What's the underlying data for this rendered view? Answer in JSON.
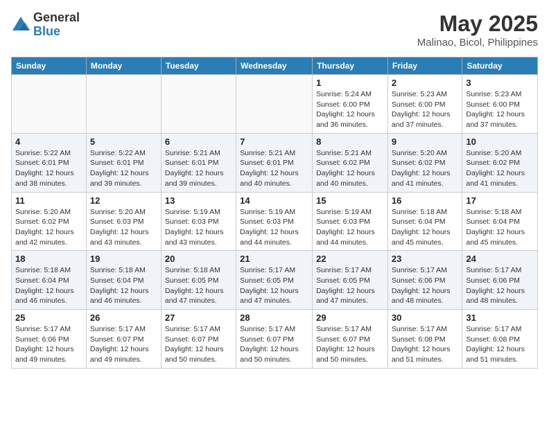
{
  "header": {
    "logo_general": "General",
    "logo_blue": "Blue",
    "title": "May 2025",
    "location": "Malinao, Bicol, Philippines"
  },
  "weekdays": [
    "Sunday",
    "Monday",
    "Tuesday",
    "Wednesday",
    "Thursday",
    "Friday",
    "Saturday"
  ],
  "weeks": [
    [
      {
        "day": "",
        "info": ""
      },
      {
        "day": "",
        "info": ""
      },
      {
        "day": "",
        "info": ""
      },
      {
        "day": "",
        "info": ""
      },
      {
        "day": "1",
        "info": "Sunrise: 5:24 AM\nSunset: 6:00 PM\nDaylight: 12 hours and 36 minutes."
      },
      {
        "day": "2",
        "info": "Sunrise: 5:23 AM\nSunset: 6:00 PM\nDaylight: 12 hours and 37 minutes."
      },
      {
        "day": "3",
        "info": "Sunrise: 5:23 AM\nSunset: 6:00 PM\nDaylight: 12 hours and 37 minutes."
      }
    ],
    [
      {
        "day": "4",
        "info": "Sunrise: 5:22 AM\nSunset: 6:01 PM\nDaylight: 12 hours and 38 minutes."
      },
      {
        "day": "5",
        "info": "Sunrise: 5:22 AM\nSunset: 6:01 PM\nDaylight: 12 hours and 39 minutes."
      },
      {
        "day": "6",
        "info": "Sunrise: 5:21 AM\nSunset: 6:01 PM\nDaylight: 12 hours and 39 minutes."
      },
      {
        "day": "7",
        "info": "Sunrise: 5:21 AM\nSunset: 6:01 PM\nDaylight: 12 hours and 40 minutes."
      },
      {
        "day": "8",
        "info": "Sunrise: 5:21 AM\nSunset: 6:02 PM\nDaylight: 12 hours and 40 minutes."
      },
      {
        "day": "9",
        "info": "Sunrise: 5:20 AM\nSunset: 6:02 PM\nDaylight: 12 hours and 41 minutes."
      },
      {
        "day": "10",
        "info": "Sunrise: 5:20 AM\nSunset: 6:02 PM\nDaylight: 12 hours and 41 minutes."
      }
    ],
    [
      {
        "day": "11",
        "info": "Sunrise: 5:20 AM\nSunset: 6:02 PM\nDaylight: 12 hours and 42 minutes."
      },
      {
        "day": "12",
        "info": "Sunrise: 5:20 AM\nSunset: 6:03 PM\nDaylight: 12 hours and 43 minutes."
      },
      {
        "day": "13",
        "info": "Sunrise: 5:19 AM\nSunset: 6:03 PM\nDaylight: 12 hours and 43 minutes."
      },
      {
        "day": "14",
        "info": "Sunrise: 5:19 AM\nSunset: 6:03 PM\nDaylight: 12 hours and 44 minutes."
      },
      {
        "day": "15",
        "info": "Sunrise: 5:19 AM\nSunset: 6:03 PM\nDaylight: 12 hours and 44 minutes."
      },
      {
        "day": "16",
        "info": "Sunrise: 5:18 AM\nSunset: 6:04 PM\nDaylight: 12 hours and 45 minutes."
      },
      {
        "day": "17",
        "info": "Sunrise: 5:18 AM\nSunset: 6:04 PM\nDaylight: 12 hours and 45 minutes."
      }
    ],
    [
      {
        "day": "18",
        "info": "Sunrise: 5:18 AM\nSunset: 6:04 PM\nDaylight: 12 hours and 46 minutes."
      },
      {
        "day": "19",
        "info": "Sunrise: 5:18 AM\nSunset: 6:04 PM\nDaylight: 12 hours and 46 minutes."
      },
      {
        "day": "20",
        "info": "Sunrise: 5:18 AM\nSunset: 6:05 PM\nDaylight: 12 hours and 47 minutes."
      },
      {
        "day": "21",
        "info": "Sunrise: 5:17 AM\nSunset: 6:05 PM\nDaylight: 12 hours and 47 minutes."
      },
      {
        "day": "22",
        "info": "Sunrise: 5:17 AM\nSunset: 6:05 PM\nDaylight: 12 hours and 47 minutes."
      },
      {
        "day": "23",
        "info": "Sunrise: 5:17 AM\nSunset: 6:06 PM\nDaylight: 12 hours and 48 minutes."
      },
      {
        "day": "24",
        "info": "Sunrise: 5:17 AM\nSunset: 6:06 PM\nDaylight: 12 hours and 48 minutes."
      }
    ],
    [
      {
        "day": "25",
        "info": "Sunrise: 5:17 AM\nSunset: 6:06 PM\nDaylight: 12 hours and 49 minutes."
      },
      {
        "day": "26",
        "info": "Sunrise: 5:17 AM\nSunset: 6:07 PM\nDaylight: 12 hours and 49 minutes."
      },
      {
        "day": "27",
        "info": "Sunrise: 5:17 AM\nSunset: 6:07 PM\nDaylight: 12 hours and 50 minutes."
      },
      {
        "day": "28",
        "info": "Sunrise: 5:17 AM\nSunset: 6:07 PM\nDaylight: 12 hours and 50 minutes."
      },
      {
        "day": "29",
        "info": "Sunrise: 5:17 AM\nSunset: 6:07 PM\nDaylight: 12 hours and 50 minutes."
      },
      {
        "day": "30",
        "info": "Sunrise: 5:17 AM\nSunset: 6:08 PM\nDaylight: 12 hours and 51 minutes."
      },
      {
        "day": "31",
        "info": "Sunrise: 5:17 AM\nSunset: 6:08 PM\nDaylight: 12 hours and 51 minutes."
      }
    ]
  ]
}
